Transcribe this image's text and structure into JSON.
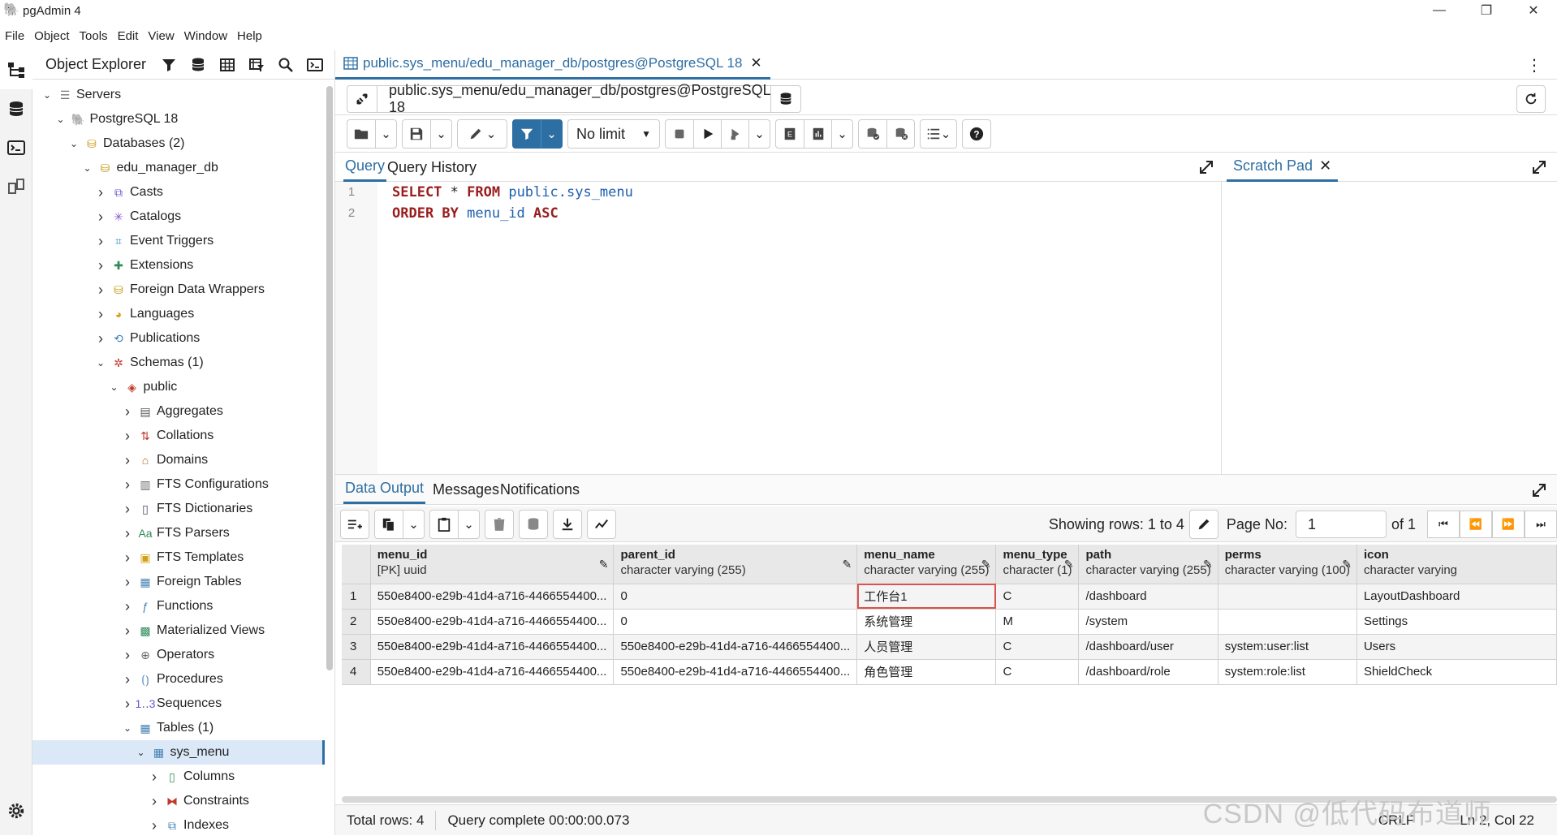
{
  "window": {
    "title": "pgAdmin 4",
    "controls": [
      "minimize-icon",
      "restore-icon",
      "close-icon"
    ]
  },
  "menu": [
    "File",
    "Object",
    "Tools",
    "Edit",
    "View",
    "Window",
    "Help"
  ],
  "explorer": {
    "title": "Object Explorer",
    "tree": [
      {
        "label": "Servers",
        "depth": 0,
        "expanded": true,
        "icon": "servers-icon"
      },
      {
        "label": "PostgreSQL 18",
        "depth": 1,
        "expanded": true,
        "icon": "elephant-icon"
      },
      {
        "label": "Databases (2)",
        "depth": 2,
        "expanded": true,
        "icon": "databases-icon"
      },
      {
        "label": "edu_manager_db",
        "depth": 3,
        "expanded": true,
        "icon": "database-icon"
      },
      {
        "label": "Casts",
        "depth": 4,
        "expanded": false,
        "icon": "cast-icon"
      },
      {
        "label": "Catalogs",
        "depth": 4,
        "expanded": false,
        "icon": "catalog-icon"
      },
      {
        "label": "Event Triggers",
        "depth": 4,
        "expanded": false,
        "icon": "event-trigger-icon"
      },
      {
        "label": "Extensions",
        "depth": 4,
        "expanded": false,
        "icon": "extension-icon"
      },
      {
        "label": "Foreign Data Wrappers",
        "depth": 4,
        "expanded": false,
        "icon": "fdw-icon"
      },
      {
        "label": "Languages",
        "depth": 4,
        "expanded": false,
        "icon": "language-icon"
      },
      {
        "label": "Publications",
        "depth": 4,
        "expanded": false,
        "icon": "publication-icon"
      },
      {
        "label": "Schemas (1)",
        "depth": 4,
        "expanded": true,
        "icon": "schemas-icon"
      },
      {
        "label": "public",
        "depth": 5,
        "expanded": true,
        "icon": "schema-icon"
      },
      {
        "label": "Aggregates",
        "depth": 6,
        "expanded": false,
        "icon": "aggregate-icon"
      },
      {
        "label": "Collations",
        "depth": 6,
        "expanded": false,
        "icon": "collation-icon"
      },
      {
        "label": "Domains",
        "depth": 6,
        "expanded": false,
        "icon": "domain-icon"
      },
      {
        "label": "FTS Configurations",
        "depth": 6,
        "expanded": false,
        "icon": "fts-config-icon"
      },
      {
        "label": "FTS Dictionaries",
        "depth": 6,
        "expanded": false,
        "icon": "fts-dictionary-icon"
      },
      {
        "label": "FTS Parsers",
        "depth": 6,
        "expanded": false,
        "icon": "fts-parser-icon"
      },
      {
        "label": "FTS Templates",
        "depth": 6,
        "expanded": false,
        "icon": "fts-template-icon"
      },
      {
        "label": "Foreign Tables",
        "depth": 6,
        "expanded": false,
        "icon": "foreign-table-icon"
      },
      {
        "label": "Functions",
        "depth": 6,
        "expanded": false,
        "icon": "function-icon"
      },
      {
        "label": "Materialized Views",
        "depth": 6,
        "expanded": false,
        "icon": "matview-icon"
      },
      {
        "label": "Operators",
        "depth": 6,
        "expanded": false,
        "icon": "operator-icon"
      },
      {
        "label": "Procedures",
        "depth": 6,
        "expanded": false,
        "icon": "procedure-icon"
      },
      {
        "label": "Sequences",
        "depth": 6,
        "expanded": false,
        "icon": "sequence-icon"
      },
      {
        "label": "Tables (1)",
        "depth": 6,
        "expanded": true,
        "icon": "tables-icon"
      },
      {
        "label": "sys_menu",
        "depth": 7,
        "expanded": true,
        "icon": "table-icon",
        "selected": true
      },
      {
        "label": "Columns",
        "depth": 8,
        "expanded": false,
        "icon": "columns-icon"
      },
      {
        "label": "Constraints",
        "depth": 8,
        "expanded": false,
        "icon": "constraints-icon"
      },
      {
        "label": "Indexes",
        "depth": 8,
        "expanded": false,
        "icon": "indexes-icon"
      }
    ]
  },
  "editor_tab": {
    "title": "public.sys_menu/edu_manager_db/postgres@PostgreSQL 18"
  },
  "connection": {
    "label": "public.sys_menu/edu_manager_db/postgres@PostgreSQL 18"
  },
  "toolbar": {
    "limit": "No limit"
  },
  "query_tabs": {
    "query": "Query",
    "history": "Query History",
    "scratch": "Scratch Pad"
  },
  "sql": {
    "line_numbers": [
      "1",
      "2"
    ],
    "line1": [
      {
        "t": "SELECT",
        "c": "kw"
      },
      {
        "t": " * ",
        "c": "op"
      },
      {
        "t": "FROM",
        "c": "kw"
      },
      {
        "t": " public.sys_menu",
        "c": "id"
      }
    ],
    "line2": [
      {
        "t": "ORDER BY",
        "c": "kw"
      },
      {
        "t": " menu_id ",
        "c": "id"
      },
      {
        "t": "ASC",
        "c": "kw"
      }
    ]
  },
  "output_tabs": {
    "data": "Data Output",
    "messages": "Messages",
    "notifications": "Notifications"
  },
  "pager": {
    "showing": "Showing rows: 1 to 4",
    "page_label": "Page No:",
    "page_value": "1",
    "of": "of 1"
  },
  "grid": {
    "columns": [
      {
        "name": "menu_id",
        "type": "[PK] uuid"
      },
      {
        "name": "parent_id",
        "type": "character varying (255)"
      },
      {
        "name": "menu_name",
        "type": "character varying (255)"
      },
      {
        "name": "menu_type",
        "type": "character (1)"
      },
      {
        "name": "path",
        "type": "character varying (255)"
      },
      {
        "name": "perms",
        "type": "character varying (100)"
      },
      {
        "name": "icon",
        "type": "character varying"
      }
    ],
    "rows": [
      [
        "1",
        "550e8400-e29b-41d4-a716-4466554400...",
        "0",
        "工作台1",
        "C",
        "/dashboard",
        "",
        "LayoutDashboard"
      ],
      [
        "2",
        "550e8400-e29b-41d4-a716-4466554400...",
        "0",
        "系统管理",
        "M",
        "/system",
        "",
        "Settings"
      ],
      [
        "3",
        "550e8400-e29b-41d4-a716-4466554400...",
        "550e8400-e29b-41d4-a716-4466554400...",
        "人员管理",
        "C",
        "/dashboard/user",
        "system:user:list",
        "Users"
      ],
      [
        "4",
        "550e8400-e29b-41d4-a716-4466554400...",
        "550e8400-e29b-41d4-a716-4466554400...",
        "角色管理",
        "C",
        "/dashboard/role",
        "system:role:list",
        "ShieldCheck"
      ]
    ]
  },
  "status": {
    "total": "Total rows: 4",
    "query": "Query complete 00:00:00.073",
    "eol": "CRLF",
    "cursor": "Ln 2, Col 22"
  },
  "watermark": "CSDN @低代码布道师",
  "colors": {
    "accent": "#2d6ea3",
    "highlight_border": "#d9534f",
    "keyword": "#9a1d1d",
    "identifier": "#1e5fae"
  }
}
